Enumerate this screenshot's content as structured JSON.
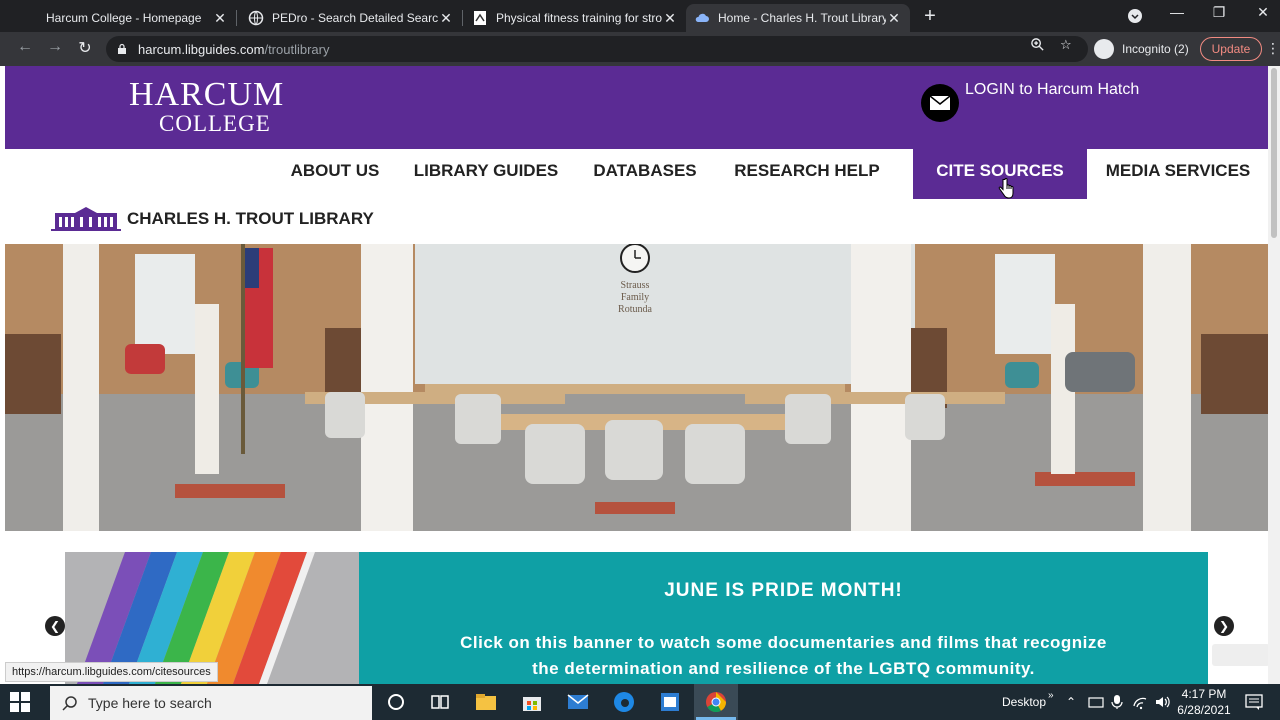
{
  "browser": {
    "tabs": [
      {
        "title": "Harcum College - Homepage",
        "active": false
      },
      {
        "title": "PEDro - Search Detailed Search R",
        "active": false
      },
      {
        "title": "Physical fitness training for strok",
        "active": false
      },
      {
        "title": "Home - Charles H. Trout Library -",
        "active": true
      }
    ],
    "new_tab": "+",
    "url_host": "harcum.libguides.com",
    "url_path": "/troutlibrary",
    "incognito_label": "Incognito (2)",
    "update_label": "Update",
    "status_url": "https://harcum.libguides.com/citesources"
  },
  "site": {
    "logo_main": "HARCUM",
    "logo_sub": "COLLEGE",
    "login_text": "LOGIN to Harcum Hatch",
    "nav": [
      {
        "label": "ABOUT US",
        "active": false
      },
      {
        "label": "LIBRARY GUIDES",
        "active": false
      },
      {
        "label": "DATABASES",
        "active": false
      },
      {
        "label": "RESEARCH HELP",
        "active": false
      },
      {
        "label": "CITE SOURCES",
        "active": true
      },
      {
        "label": "MEDIA SERVICES",
        "active": false
      }
    ],
    "library_title": "CHARLES H. TROUT LIBRARY",
    "hero_sign": [
      "Strauss",
      "Family",
      "Rotunda"
    ],
    "banner": {
      "title": "JUNE IS PRIDE MONTH!",
      "body_line1": "Click on this banner to watch some documentaries and films that recognize",
      "body_line2": "the determination and resilience of the LGBTQ community."
    },
    "colors": {
      "brand_purple": "#5b2b94",
      "banner_teal": "#0fa0a5"
    }
  },
  "taskbar": {
    "search_placeholder": "Type here to search",
    "desktop_label": "Desktop",
    "time": "4:17 PM",
    "date": "6/28/2021"
  }
}
